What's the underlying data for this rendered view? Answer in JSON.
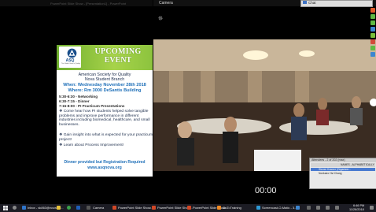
{
  "top_title": "PowerPoint Slide Show - [Presentation1] - PowerPoint",
  "slide": {
    "logo_text": "ASQ",
    "logo_sub": "The Global Voice of Quality",
    "heading_line1": "UPCOMING",
    "heading_line2": "EVENT",
    "org_line1": "American Society for Quality",
    "org_line2": "Nova Student Branch",
    "when": "When: Wednesday November 28th 2018",
    "where": "Where: Rm 3000 DeSantis Building",
    "schedule": [
      "5:30-6:30 - Networking",
      "6:30-7:15 - Dinner",
      "7:15-8:00 - PI Practicum Presentations"
    ],
    "bullets": [
      "Come hear how PI students helped solve tangible problems and improve performance in different industries including biomedical, healthcare, and small businesses.",
      "Gain insight into what is expected for your practicum project!",
      "Learn about Process Improvement!"
    ],
    "footer1": "Dinner provided but Registration Required",
    "footer2": "www.asqnova.org"
  },
  "camera": {
    "title": "Camera",
    "timer": "00:00"
  },
  "chat": {
    "label": "Chat"
  },
  "attendees": {
    "header": "Attendees - 2 of 202 (max)",
    "sort_label": "NAMES - ALPHABETICALLY",
    "rows": [
      "Steven Kramer (Organizer...",
      "Nonkaeo Hsi Chang"
    ]
  },
  "taskbar": {
    "items": [
      {
        "label": "Inbox - sk863@nova.ed...",
        "icon": "outlook-icon"
      },
      {
        "label": "Camera",
        "icon": "camera-icon"
      },
      {
        "label": "PowerPoint Slide Show...",
        "icon": "powerpoint-icon"
      },
      {
        "label": "PowerPoint Slide Show...",
        "icon": "powerpoint-icon"
      },
      {
        "label": "PowerPoint Slide Show...",
        "icon": "powerpoint-icon"
      },
      {
        "label": "GoToTraining",
        "icon": "gototraining-icon"
      },
      {
        "label": "Screencast-O-Matic - 3...",
        "icon": "screencast-icon"
      }
    ],
    "time": "6:46 PM",
    "date": "11/28/2018"
  },
  "colors": {
    "banner_green": "#8cc33e",
    "slide_blue": "#1e6fb8",
    "taskbar_bg": "#1c1c24"
  }
}
